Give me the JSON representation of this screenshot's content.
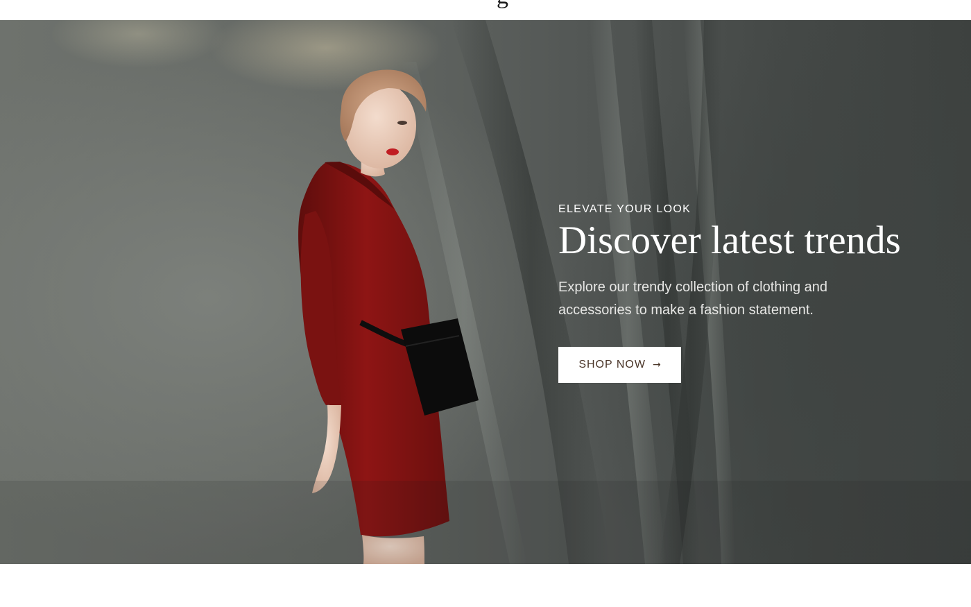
{
  "header": {
    "partial_title_glyph": "g"
  },
  "hero": {
    "eyebrow": "ELEVATE YOUR LOOK",
    "headline": "Discover latest trends",
    "description": "Explore our trendy collection of clothing and accessories to make a fashion statement.",
    "cta_label": "SHOP NOW",
    "cta_icon": "arrow-right-icon",
    "image_subject": "model-in-red-dress-photo"
  },
  "colors": {
    "background": "#ffffff",
    "hero_text": "#ffffff",
    "button_bg": "#ffffff",
    "button_text": "#4a3528",
    "dress_red": "#8e1514"
  }
}
